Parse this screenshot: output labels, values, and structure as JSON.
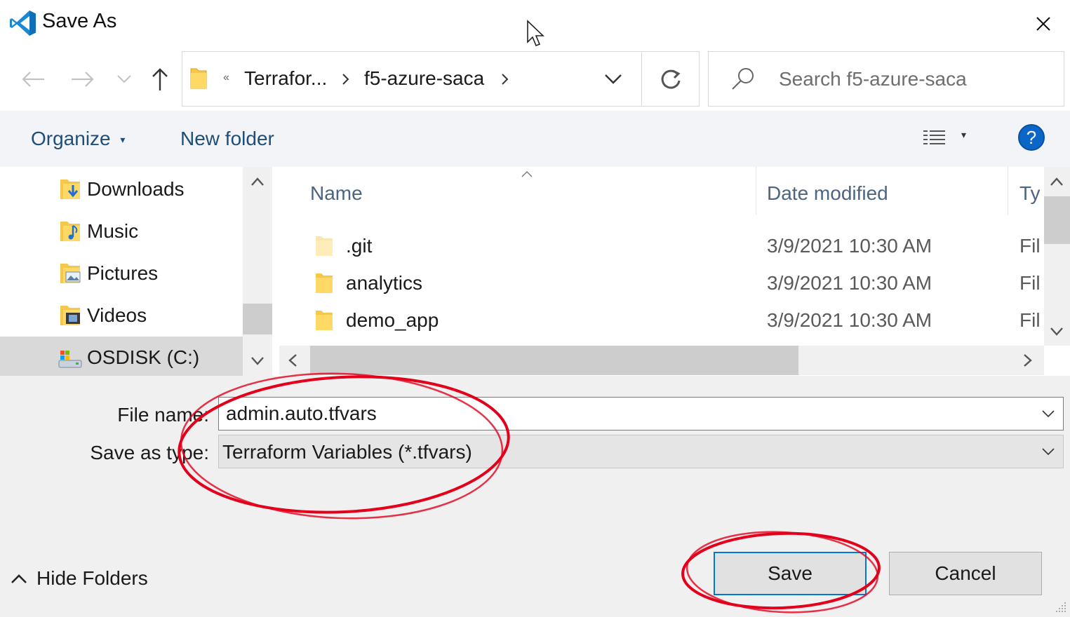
{
  "window": {
    "title": "Save As",
    "close_icon": "close-icon"
  },
  "nav": {
    "back_icon": "arrow-left-icon",
    "forward_icon": "arrow-right-icon",
    "recent_icon": "chevron-down-icon",
    "up_icon": "arrow-up-icon",
    "address": {
      "overflow_marker": "«",
      "crumbs": [
        "Terrafor...",
        "f5-azure-saca"
      ]
    },
    "refresh_icon": "refresh-icon",
    "search": {
      "placeholder": "Search f5-azure-saca",
      "icon": "search-icon"
    }
  },
  "toolbar": {
    "organize_label": "Organize",
    "new_folder_label": "New folder",
    "view_icon": "details-view-icon",
    "help_label": "?"
  },
  "nav_pane": {
    "items": [
      {
        "label": "Downloads",
        "icon": "downloads-folder-icon"
      },
      {
        "label": "Music",
        "icon": "music-folder-icon"
      },
      {
        "label": "Pictures",
        "icon": "pictures-folder-icon"
      },
      {
        "label": "Videos",
        "icon": "videos-folder-icon"
      },
      {
        "label": "OSDISK (C:)",
        "icon": "drive-icon",
        "selected": true
      }
    ]
  },
  "file_list": {
    "columns": [
      "Name",
      "Date modified",
      "Type"
    ],
    "column_type_visible": "Ty",
    "rows": [
      {
        "name": ".git",
        "date": "3/9/2021 10:30 AM",
        "type": "File folder",
        "type_visible": "Fil",
        "hidden": true
      },
      {
        "name": "analytics",
        "date": "3/9/2021 10:30 AM",
        "type": "File folder",
        "type_visible": "Fil"
      },
      {
        "name": "demo_app",
        "date": "3/9/2021 10:30 AM",
        "type": "File folder",
        "type_visible": "Fil"
      }
    ]
  },
  "form": {
    "file_name_label": "File name:",
    "file_name_value": "admin.auto.tfvars",
    "save_type_label": "Save as type:",
    "save_type_value": "Terraform Variables (*.tfvars)"
  },
  "buttons": {
    "save": "Save",
    "cancel": "Cancel",
    "hide_folders": "Hide Folders"
  },
  "colors": {
    "accent": "#0078d7",
    "annotation": "#e3001b",
    "toolbar_text": "#1f4e79",
    "folder_yellow": "#f5c84c"
  }
}
